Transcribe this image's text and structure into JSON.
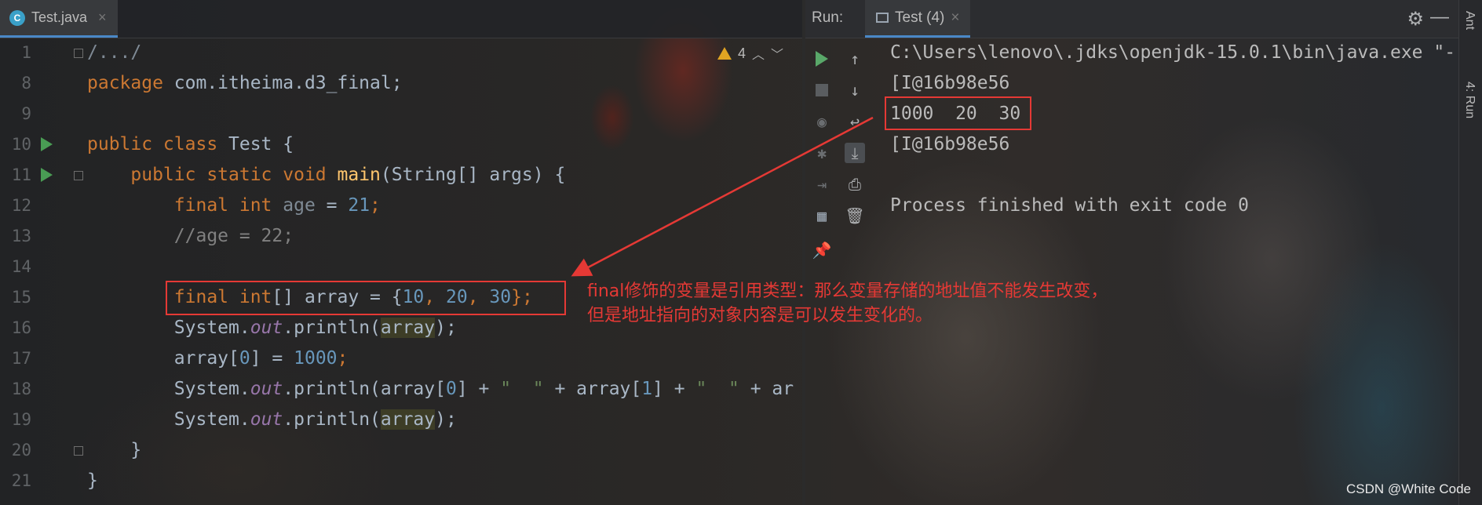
{
  "editor": {
    "tab": {
      "icon_letter": "C",
      "label": "Test.java",
      "close": "×"
    },
    "line_numbers": [
      "1",
      "8",
      "9",
      "10",
      "11",
      "12",
      "13",
      "14",
      "15",
      "16",
      "17",
      "18",
      "19",
      "20",
      "21"
    ],
    "inspection": {
      "warnings": "4"
    }
  },
  "code_lines": {
    "l1": "/.../",
    "l8a": "package",
    "l8b": " com.itheima.d3_final;",
    "l10a": "public class",
    "l10b": " Test {",
    "l11a": "    public static void ",
    "l11b": "main",
    "l11c": "(String[] args) {",
    "l12a": "        final int ",
    "l12b": "age",
    "l12c": " = ",
    "l12d": "21",
    "l12e": ";",
    "l13": "        //age = 22;",
    "l15a": "        final int",
    "l15b": "[] array = {",
    "l15c": "10",
    "l15d": ", ",
    "l15e": "20",
    "l15f": ", ",
    "l15g": "30",
    "l15h": "};",
    "l16a": "        System.",
    "l16b": "out",
    "l16c": ".println(",
    "l16d": "array",
    "l16e": ");",
    "l17a": "        array[",
    "l17b": "0",
    "l17c": "] = ",
    "l17d": "1000",
    "l17e": ";",
    "l18a": "        System.",
    "l18b": "out",
    "l18c": ".println(array[",
    "l18d": "0",
    "l18e": "] + ",
    "l18f": "\"  \"",
    "l18g": " + array[",
    "l18h": "1",
    "l18i": "] + ",
    "l18j": "\"  \"",
    "l18k": " + ar",
    "l19a": "        System.",
    "l19b": "out",
    "l19c": ".println(",
    "l19d": "array",
    "l19e": ");",
    "l20": "    }",
    "l21": "}"
  },
  "run": {
    "label": "Run:",
    "tab_label": "Test (4)",
    "tab_close": "×",
    "output": [
      "C:\\Users\\lenovo\\.jdks\\openjdk-15.0.1\\bin\\java.exe \"-",
      "[I@16b98e56",
      "1000  20  30",
      "[I@16b98e56",
      "",
      "Process finished with exit code 0"
    ]
  },
  "side_tabs": {
    "ant": "Ant",
    "run": "4: Run"
  },
  "annotation": {
    "line1": "final修饰的变量是引用类型：那么变量存储的地址值不能发生改变，",
    "line2": "但是地址指向的对象内容是可以发生变化的。"
  },
  "watermark": "CSDN @White Code",
  "colors": {
    "annotation_red": "#e53935",
    "keyword": "#cc7832",
    "number": "#6897bb"
  }
}
